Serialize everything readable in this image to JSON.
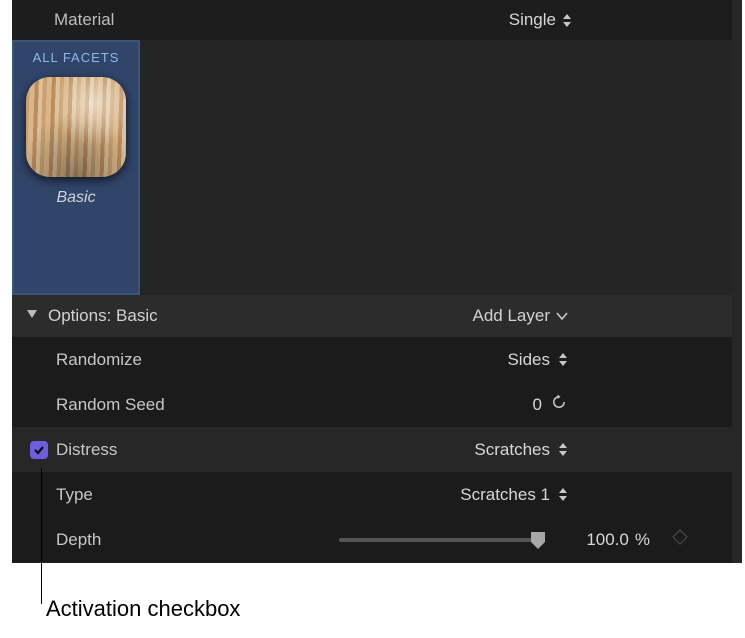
{
  "header": {
    "material_label": "Material",
    "material_mode": "Single"
  },
  "facets": {
    "tab_label": "ALL FACETS",
    "thumb_name": "Basic"
  },
  "options": {
    "title": "Options: Basic",
    "add_layer_label": "Add Layer"
  },
  "params": {
    "randomize": {
      "label": "Randomize",
      "value": "Sides"
    },
    "random_seed": {
      "label": "Random Seed",
      "value": "0"
    },
    "distress": {
      "label": "Distress",
      "value": "Scratches",
      "checked": true
    },
    "type": {
      "label": "Type",
      "value": "Scratches 1"
    },
    "depth": {
      "label": "Depth",
      "value": "100.0",
      "unit": "%"
    }
  },
  "callout": "Activation checkbox",
  "colors": {
    "checkbox_bg": "#6f5de0",
    "selection_bg": "#3a5576"
  }
}
